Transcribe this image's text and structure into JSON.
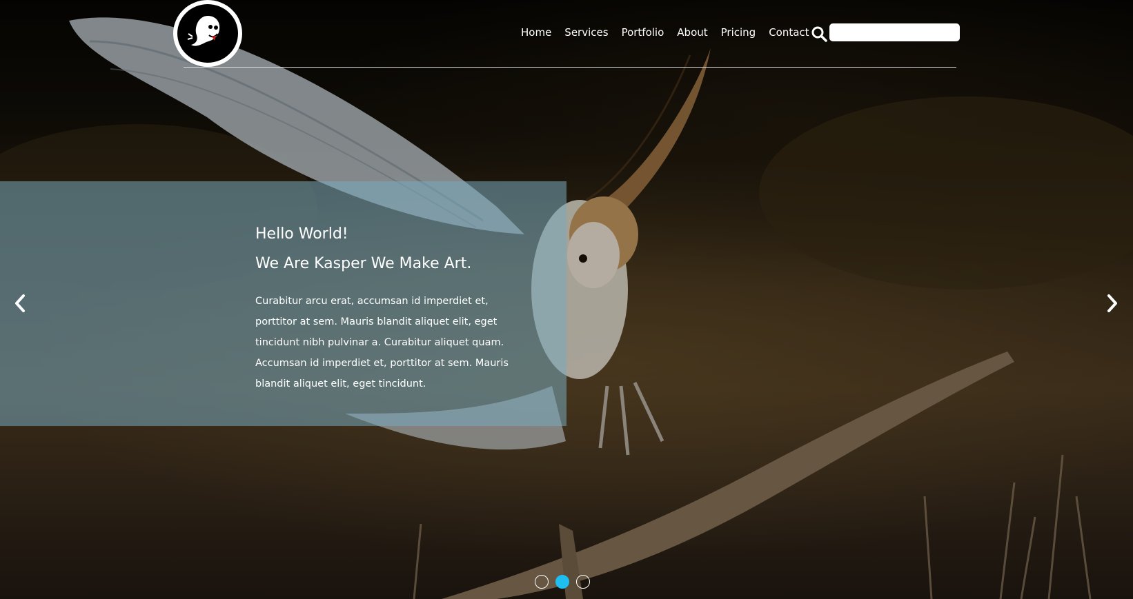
{
  "nav": {
    "items": [
      "Home",
      "Services",
      "Portfolio",
      "About",
      "Pricing",
      "Contact"
    ]
  },
  "search": {
    "placeholder": "",
    "value": ""
  },
  "slide": {
    "heading_1": "Hello World!",
    "heading_2": "We Are Kasper We Make Art.",
    "body": "Curabitur arcu erat, accumsan id imperdiet et, porttitor at sem. Mauris blandit aliquet elit, eget tincidunt nibh pulvinar a. Curabitur aliquet quam. Accumsan id imperdiet et, porttitor at sem. Mauris blandit aliquet elit, eget tincidunt."
  },
  "carousel": {
    "slide_count": 3,
    "active_index": 1
  },
  "colors": {
    "accent": "#1ebff0",
    "caption_panel": "rgba(120,170,190,0.55)"
  },
  "icons": {
    "logo": "ghost-logo-icon",
    "search": "search-icon",
    "prev": "chevron-left-icon",
    "next": "chevron-right-icon"
  }
}
